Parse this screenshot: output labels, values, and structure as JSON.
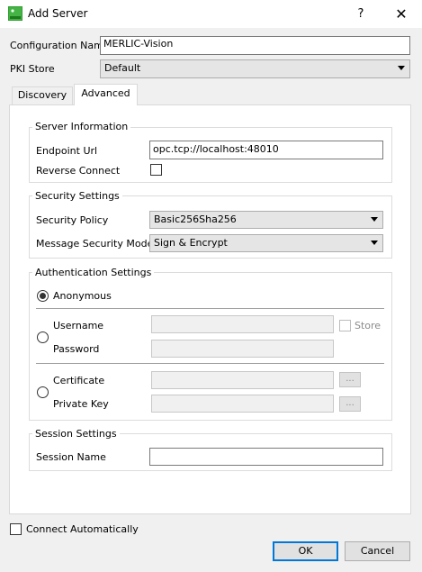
{
  "window": {
    "title": "Add Server",
    "help_glyph": "?",
    "close_glyph": "✕"
  },
  "config": {
    "configuration_name_label": "Configuration Name",
    "configuration_name_value": "MERLIC-Vision",
    "pki_store_label": "PKI Store",
    "pki_store_value": "Default"
  },
  "tabs": [
    {
      "label": "Discovery",
      "active": false
    },
    {
      "label": "Advanced",
      "active": true
    }
  ],
  "server_info": {
    "title": "Server Information",
    "endpoint_label": "Endpoint Url",
    "endpoint_value": "opc.tcp://localhost:48010",
    "reverse_connect_label": "Reverse Connect",
    "reverse_connect_checked": false
  },
  "security": {
    "title": "Security Settings",
    "policy_label": "Security Policy",
    "policy_value": "Basic256Sha256",
    "mode_label": "Message Security Mode",
    "mode_value": "Sign & Encrypt"
  },
  "auth": {
    "title": "Authentication Settings",
    "anonymous_label": "Anonymous",
    "username_label": "Username",
    "password_label": "Password",
    "store_label": "Store",
    "certificate_label": "Certificate",
    "private_key_label": "Private Key",
    "browse_label": "...",
    "selected": "anonymous"
  },
  "session": {
    "title": "Session Settings",
    "name_label": "Session Name",
    "name_value": ""
  },
  "footer": {
    "connect_auto_label": "Connect Automatically",
    "connect_auto_checked": false,
    "ok_label": "OK",
    "cancel_label": "Cancel"
  },
  "colors": {
    "accent": "#0078d7",
    "icon_green": "#2e9e2e"
  }
}
